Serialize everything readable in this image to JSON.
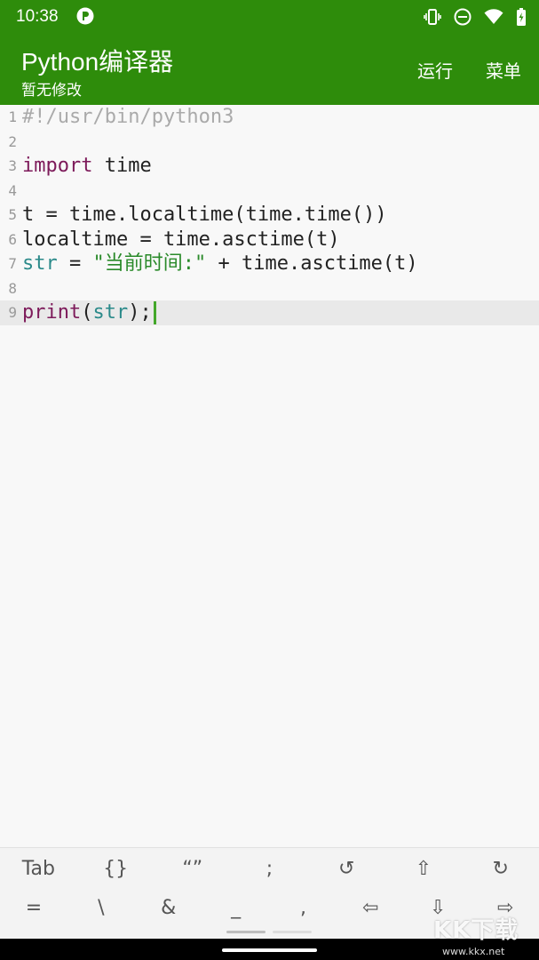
{
  "status_bar": {
    "time": "10:38",
    "icons": [
      "app-notification-icon",
      "vibrate-icon",
      "do-not-disturb-icon",
      "wifi-icon",
      "battery-icon"
    ]
  },
  "toolbar": {
    "title": "Python编译器",
    "subtitle": "暂无修改",
    "run_label": "运行",
    "menu_label": "菜单",
    "background_color": "#2e8c0b"
  },
  "editor": {
    "current_line": 9,
    "lines": [
      {
        "number": "1",
        "tokens": [
          {
            "type": "comment",
            "text": "#!/usr/bin/python3"
          }
        ]
      },
      {
        "number": "2",
        "tokens": []
      },
      {
        "number": "3",
        "tokens": [
          {
            "type": "keyword",
            "text": "import"
          },
          {
            "type": "default",
            "text": " time"
          }
        ]
      },
      {
        "number": "4",
        "tokens": []
      },
      {
        "number": "5",
        "tokens": [
          {
            "type": "default",
            "text": "t = time.localtime(time.time())"
          }
        ]
      },
      {
        "number": "6",
        "tokens": [
          {
            "type": "default",
            "text": "localtime = time.asctime(t)"
          }
        ]
      },
      {
        "number": "7",
        "tokens": [
          {
            "type": "builtin",
            "text": "str"
          },
          {
            "type": "default",
            "text": " = "
          },
          {
            "type": "string",
            "text": "\"当前时间:\""
          },
          {
            "type": "default",
            "text": " + time.asctime(t)"
          }
        ]
      },
      {
        "number": "8",
        "tokens": []
      },
      {
        "number": "9",
        "tokens": [
          {
            "type": "keyword",
            "text": "print"
          },
          {
            "type": "default",
            "text": "("
          },
          {
            "type": "builtin",
            "text": "str"
          },
          {
            "type": "default",
            "text": ");"
          }
        ]
      }
    ]
  },
  "symbol_bar": {
    "row1": [
      {
        "name": "tab-key",
        "label": "Tab"
      },
      {
        "name": "braces-key",
        "label": "{}"
      },
      {
        "name": "quotes-key",
        "label": "“”"
      },
      {
        "name": "semicolon-key",
        "label": ";"
      },
      {
        "name": "undo-key",
        "label": "↺"
      },
      {
        "name": "arrow-up-key",
        "label": "⇧"
      },
      {
        "name": "redo-key",
        "label": "↻"
      }
    ],
    "row2": [
      {
        "name": "equals-key",
        "label": "="
      },
      {
        "name": "backslash-key",
        "label": "\\"
      },
      {
        "name": "ampersand-key",
        "label": "&"
      },
      {
        "name": "underscore-key",
        "label": "_"
      },
      {
        "name": "comma-key",
        "label": ","
      },
      {
        "name": "arrow-left-key",
        "label": "⇦"
      },
      {
        "name": "arrow-down-key",
        "label": "⇩"
      },
      {
        "name": "arrow-right-key",
        "label": "⇨"
      }
    ]
  },
  "watermark": {
    "text": "KK下载",
    "url": "www.kkx.net"
  }
}
